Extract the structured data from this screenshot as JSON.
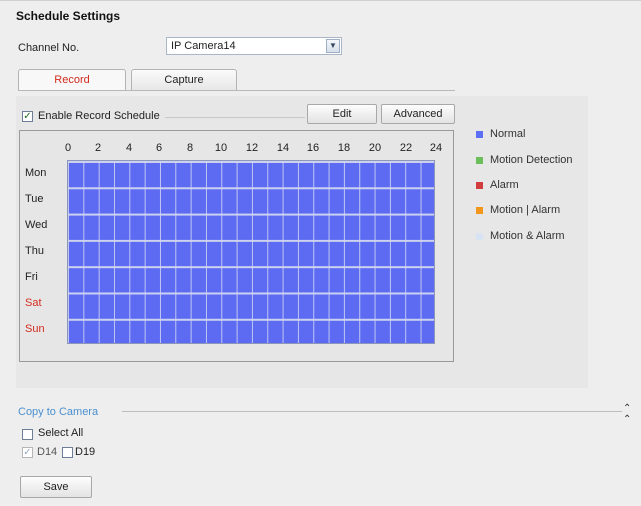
{
  "page": {
    "title": "Schedule Settings"
  },
  "channel": {
    "label": "Channel No.",
    "selected": "IP Camera14"
  },
  "tabs": [
    {
      "label": "Record",
      "active": true
    },
    {
      "label": "Capture",
      "active": false
    }
  ],
  "schedule": {
    "enable_label": "Enable Record Schedule",
    "enable_checked": true,
    "edit_label": "Edit",
    "advanced_label": "Advanced",
    "hours": [
      "0",
      "2",
      "4",
      "6",
      "8",
      "10",
      "12",
      "14",
      "16",
      "18",
      "20",
      "22",
      "24"
    ],
    "days": [
      {
        "label": "Mon",
        "weekend": false
      },
      {
        "label": "Tue",
        "weekend": false
      },
      {
        "label": "Wed",
        "weekend": false
      },
      {
        "label": "Thu",
        "weekend": false
      },
      {
        "label": "Fri",
        "weekend": false
      },
      {
        "label": "Sat",
        "weekend": true
      },
      {
        "label": "Sun",
        "weekend": true
      }
    ],
    "fill_color": "#5c6bf2"
  },
  "legend": [
    {
      "label": "Normal",
      "color": "#5b6ef5"
    },
    {
      "label": "Motion Detection",
      "color": "#6abf5a"
    },
    {
      "label": "Alarm",
      "color": "#d23c3c"
    },
    {
      "label": "Motion | Alarm",
      "color": "#f2961e"
    },
    {
      "label": "Motion & Alarm",
      "color": "#d8e4f4"
    }
  ],
  "copy": {
    "label": "Copy to Camera",
    "collapse_icon": "double-chevron-up-icon",
    "select_all_label": "Select All",
    "cameras": [
      {
        "label": "D14",
        "checked": true,
        "disabled": true
      },
      {
        "label": "D19",
        "checked": false,
        "disabled": false
      }
    ]
  },
  "save_label": "Save"
}
